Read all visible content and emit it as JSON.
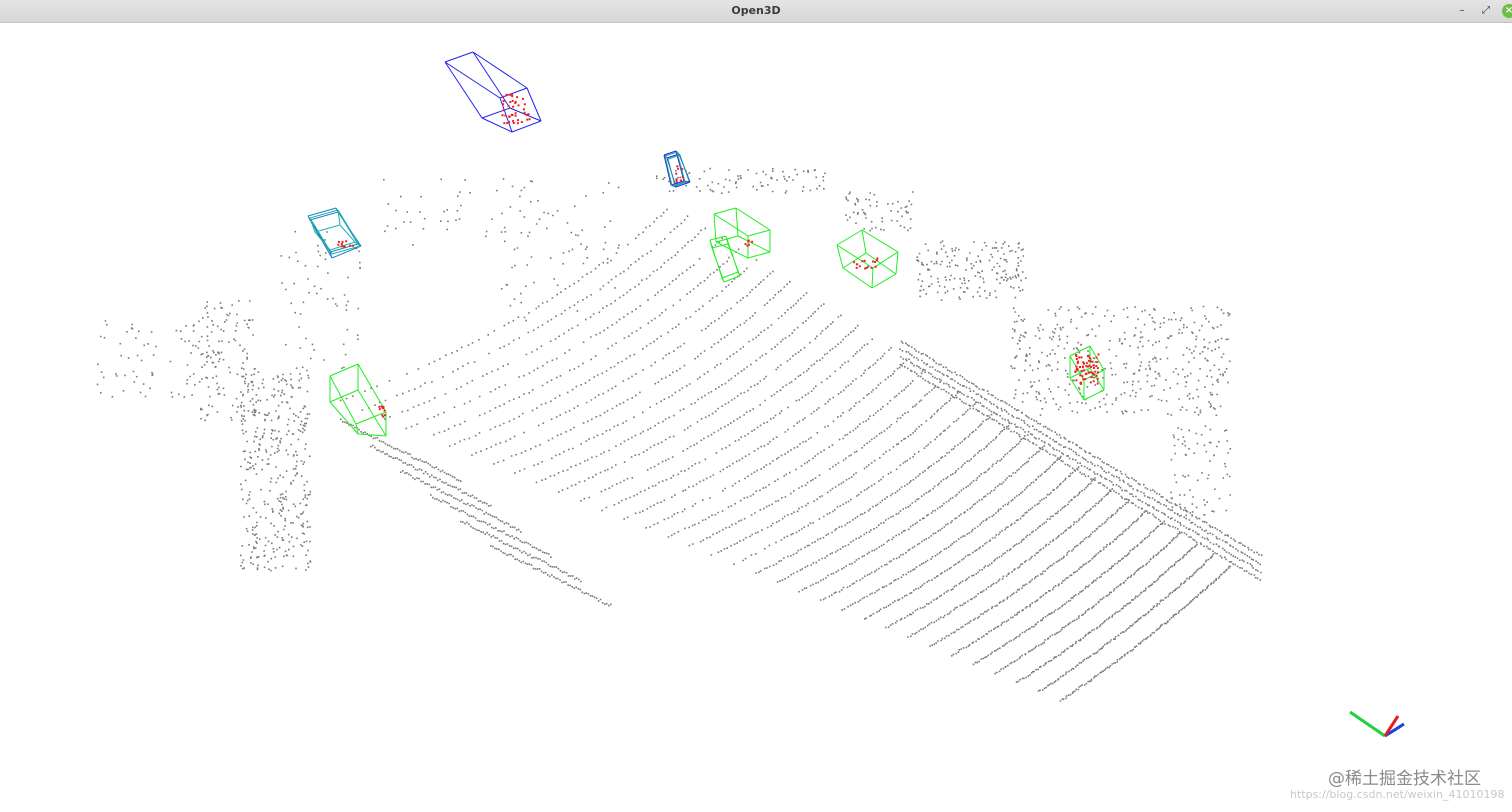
{
  "window": {
    "title": "Open3D"
  },
  "controls": {
    "minimize": "–",
    "maximize": "⤢",
    "close": "×"
  },
  "colors": {
    "points": "#7a7a7a",
    "gt_box": "#22ee22",
    "pred_box": "#2222ee",
    "box_points": "#ee2222",
    "axis_x": "#e02020",
    "axis_y": "#20d040",
    "axis_z": "#2040e0"
  },
  "icons": [
    "minimize-icon",
    "maximize-icon",
    "close-icon"
  ],
  "watermark": {
    "brand": "@稀土掘金技术社区",
    "url": "https://blog.csdn.net/weixin_41010198"
  }
}
